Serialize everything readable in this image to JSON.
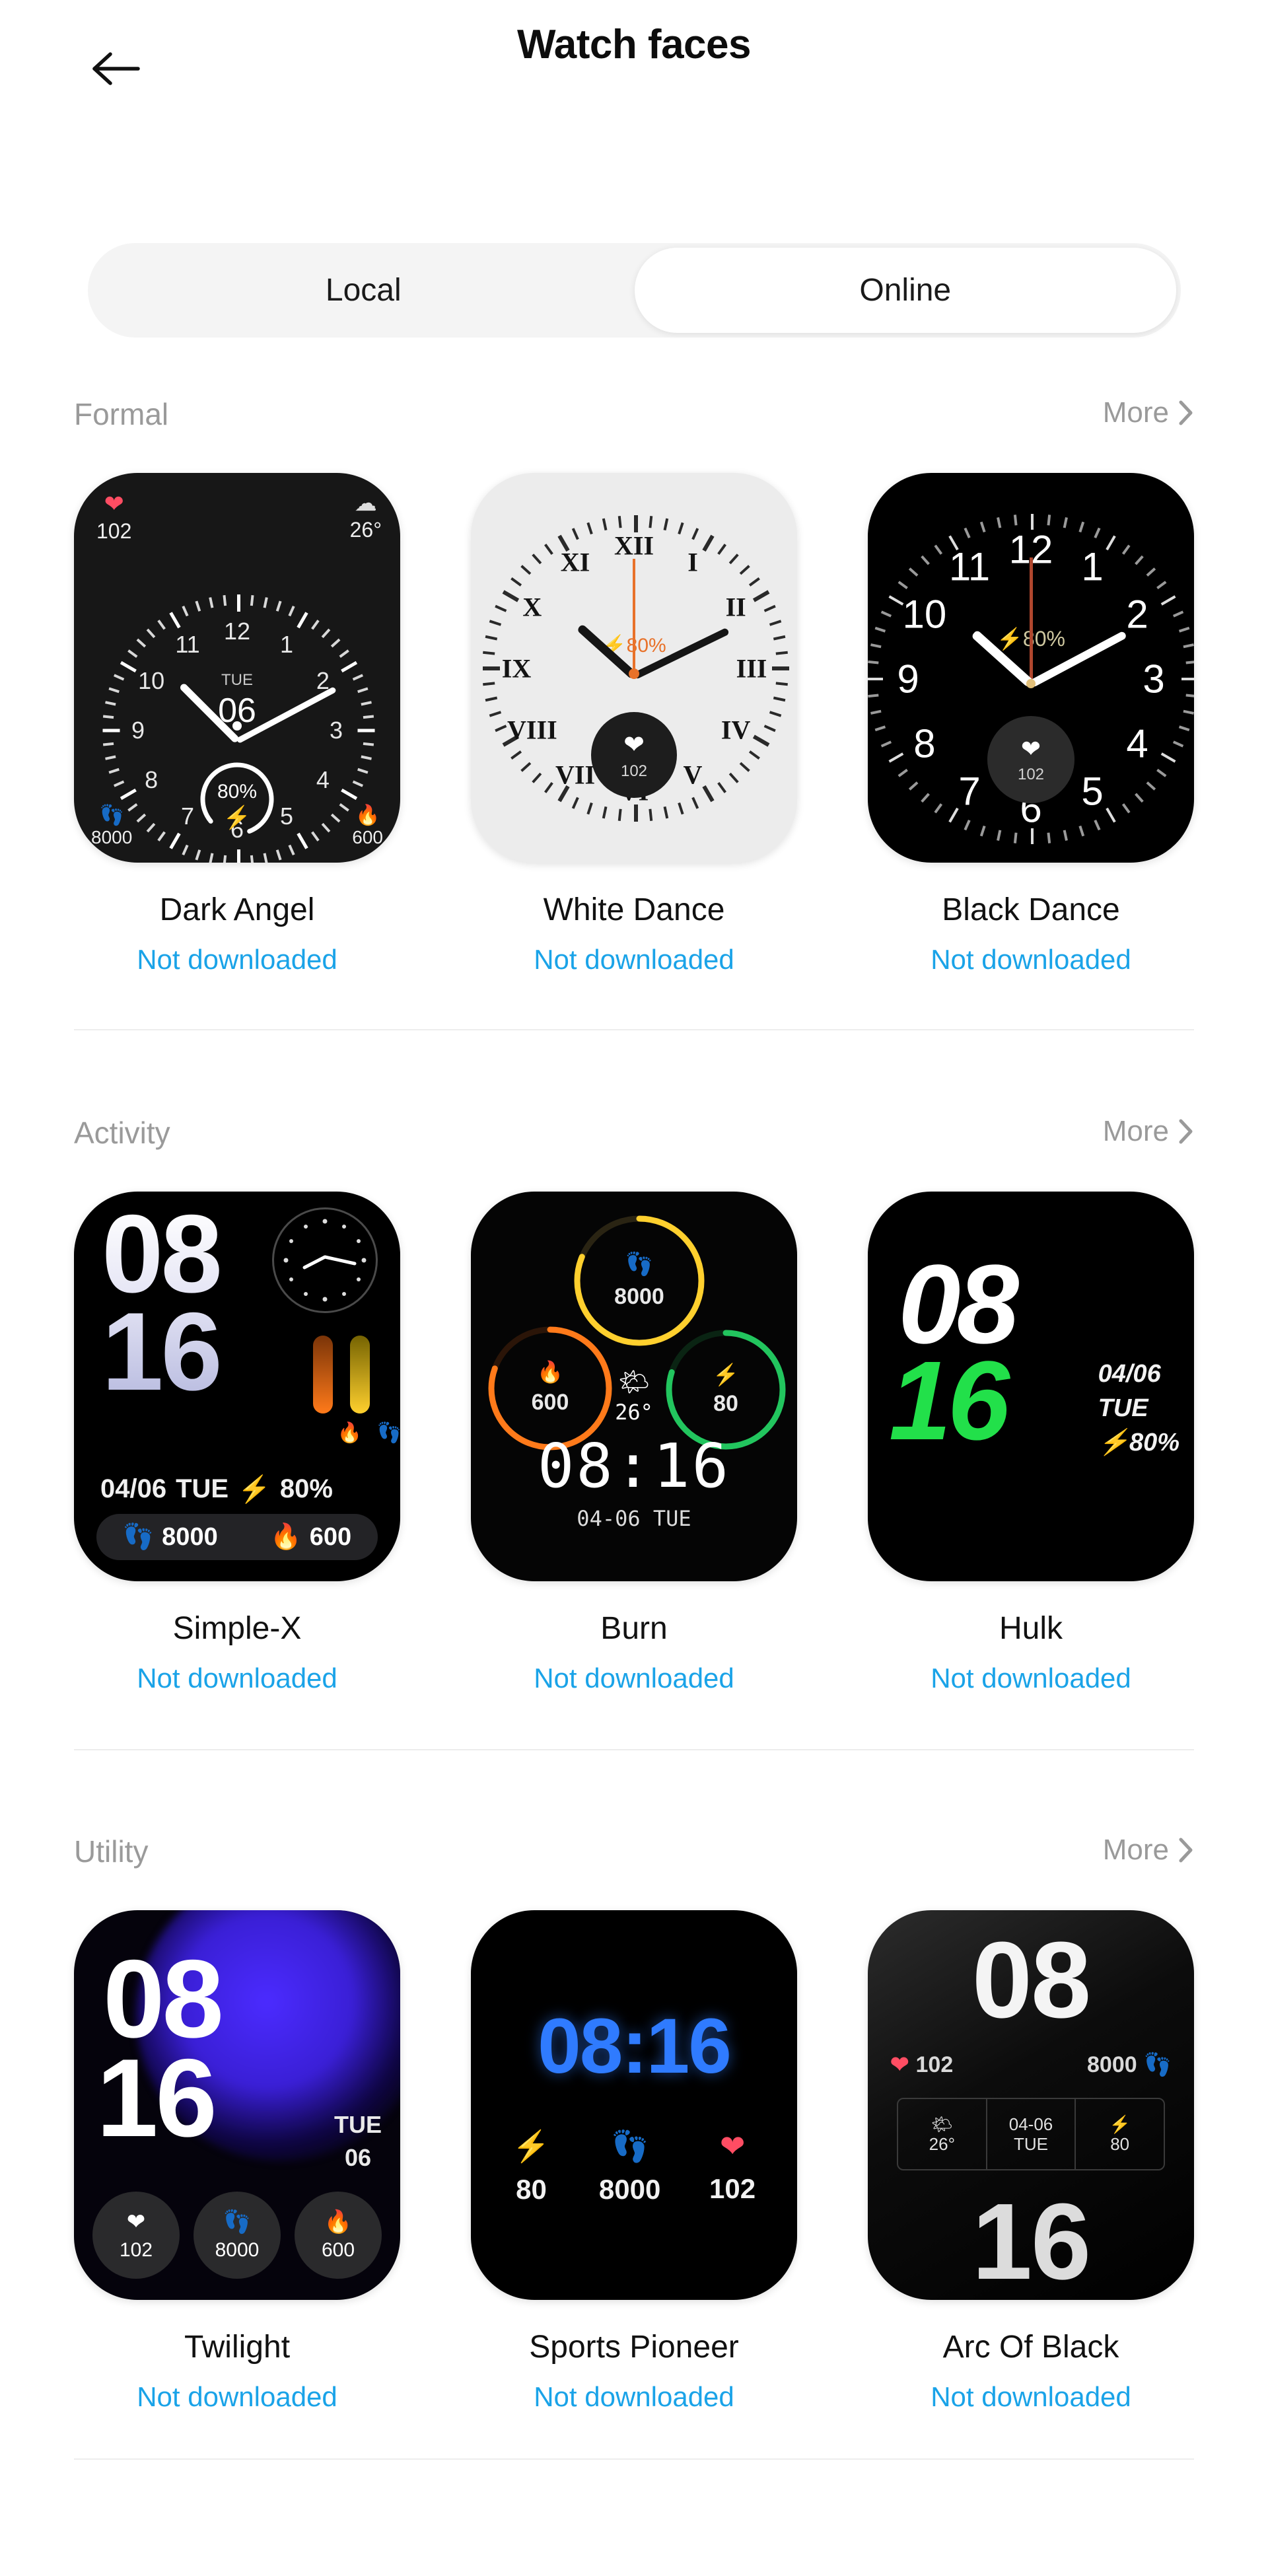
{
  "header": {
    "title": "Watch faces",
    "back_icon": "arrow-left-icon"
  },
  "tabs": {
    "items": [
      {
        "label": "Local",
        "active": false
      },
      {
        "label": "Online",
        "active": true
      }
    ]
  },
  "more_label": "More",
  "status_not_downloaded": "Not downloaded",
  "colors": {
    "status_blue": "#1aa3e8",
    "section_gray": "#9a9a9a",
    "tab_track": "#f4f4f4",
    "hulk_green": "#22e04a",
    "sports_blue": "#2f7bff",
    "twilight_purple": "#4b2bff"
  },
  "sections": [
    {
      "title": "Formal",
      "more": "More",
      "faces": [
        {
          "name": "Dark Angel",
          "status": "Not downloaded",
          "data": {
            "hr": "102",
            "temp": "26°",
            "weekday": "TUE",
            "day": "06",
            "battery": "80%",
            "steps": "8000",
            "calories": "600"
          }
        },
        {
          "name": "White Dance",
          "status": "Not downloaded",
          "data": {
            "battery": "80%",
            "hr": "102",
            "numerals": [
              "XII",
              "I",
              "II",
              "III",
              "IV",
              "V",
              "VI",
              "VII",
              "VIII",
              "IX",
              "X",
              "XI"
            ]
          }
        },
        {
          "name": "Black Dance",
          "status": "Not downloaded",
          "data": {
            "battery": "80%",
            "hr": "102",
            "numerals": [
              "12",
              "1",
              "2",
              "3",
              "4",
              "5",
              "6",
              "7",
              "8",
              "9",
              "10",
              "11"
            ]
          }
        }
      ]
    },
    {
      "title": "Activity",
      "more": "More",
      "faces": [
        {
          "name": "Simple-X",
          "status": "Not downloaded",
          "data": {
            "hour": "08",
            "minute": "16",
            "date": "04/06",
            "weekday": "TUE",
            "battery": "80%",
            "steps": "8000",
            "calories": "600"
          }
        },
        {
          "name": "Burn",
          "status": "Not downloaded",
          "data": {
            "steps": "8000",
            "calories": "600",
            "battery": "80",
            "temp": "26°",
            "time": "08:16",
            "date": "04-06 TUE"
          }
        },
        {
          "name": "Hulk",
          "status": "Not downloaded",
          "data": {
            "hour": "08",
            "minute": "16",
            "date": "04/06",
            "weekday": "TUE",
            "battery": "80%"
          }
        }
      ]
    },
    {
      "title": "Utility",
      "more": "More",
      "faces": [
        {
          "name": "Twilight",
          "status": "Not downloaded",
          "data": {
            "hour": "08",
            "minute": "16",
            "weekday": "TUE",
            "day": "06",
            "hr": "102",
            "steps": "8000",
            "calories": "600"
          }
        },
        {
          "name": "Sports Pioneer",
          "status": "Not downloaded",
          "data": {
            "time": "08:16",
            "battery": "80",
            "steps": "8000",
            "hr": "102"
          }
        },
        {
          "name": "Arc Of Black",
          "status": "Not downloaded",
          "data": {
            "hour": "08",
            "minute": "16",
            "hr": "102",
            "steps": "8000",
            "temp": "26°",
            "date": "04-06",
            "weekday": "TUE",
            "battery": "80"
          }
        }
      ]
    }
  ]
}
